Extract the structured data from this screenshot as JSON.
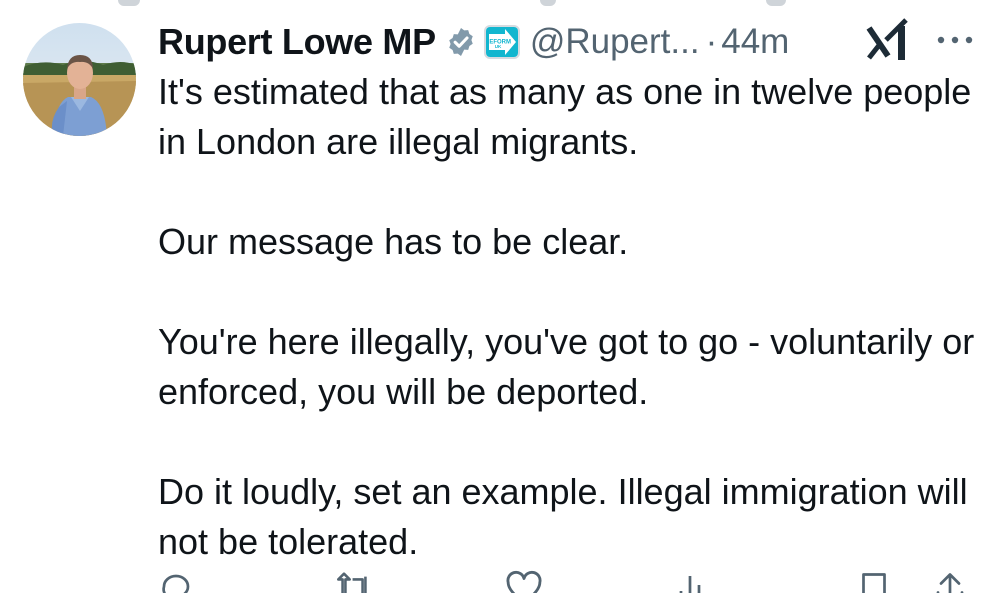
{
  "author": {
    "display_name": "Rupert Lowe MP",
    "handle": "@Rupert...",
    "separator": "·",
    "time": "44m",
    "affiliate_badge_text": "REFORM UK"
  },
  "tweet": {
    "paragraphs": [
      "It's estimated that as many as one in twelve people in London are illegal migrants.",
      "Our message has to be clear.",
      "You're here illegally, you've got to go - voluntarily or enforced, you will be deported.",
      "Do it loudly, set an example. Illegal immigration will not be tolerated."
    ]
  },
  "actions": {
    "reply_count": "",
    "repost_count": "",
    "like_count": "",
    "views_count": ""
  },
  "icons": {
    "verified": "verified-badge-icon",
    "grok": "grok-icon",
    "more": "more-icon",
    "reply": "reply-icon",
    "repost": "repost-icon",
    "like": "like-icon",
    "views": "views-icon",
    "bookmark": "bookmark-icon",
    "share": "share-icon"
  },
  "colors": {
    "text": "#0f1419",
    "secondary": "#536471",
    "verified_grey": "#829aab",
    "reform_cyan": "#12b6cf"
  }
}
